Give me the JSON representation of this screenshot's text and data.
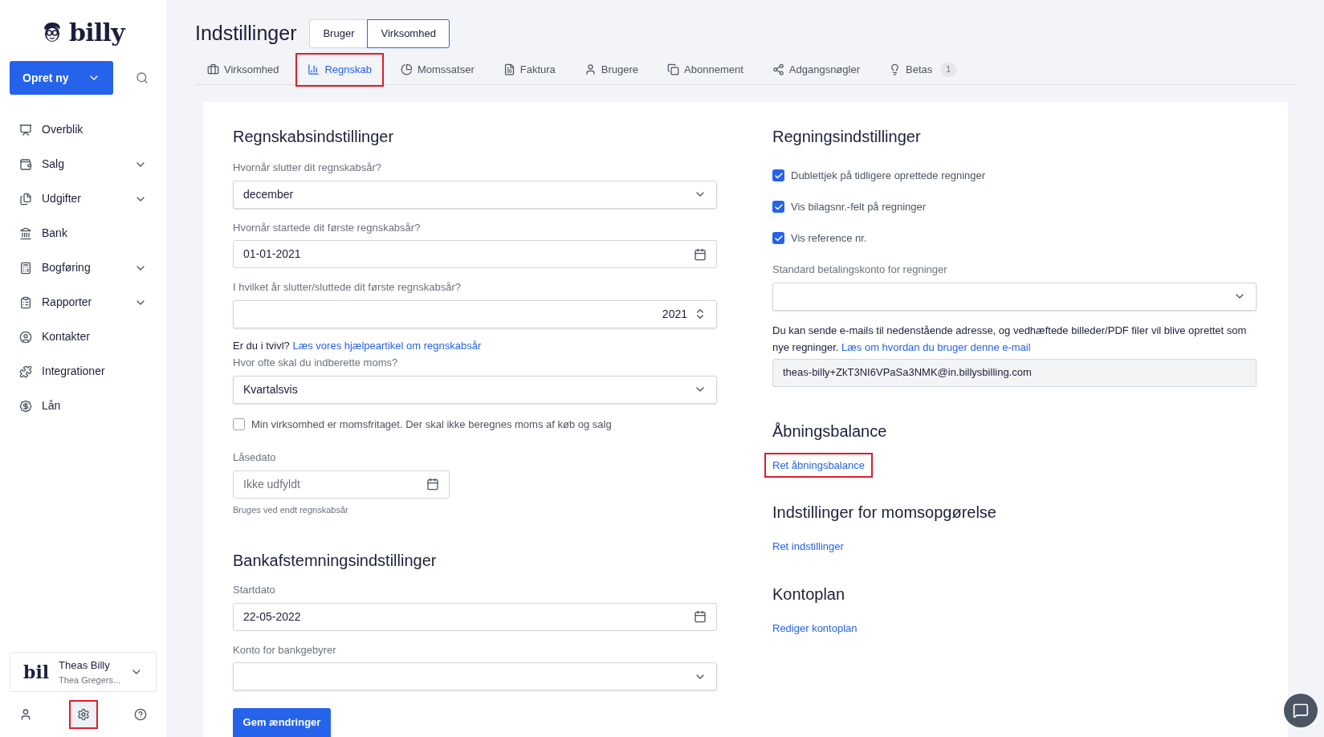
{
  "sidebar": {
    "logo": "billy",
    "create_button": "Opret ny",
    "nav": [
      {
        "label": "Overblik",
        "expandable": false
      },
      {
        "label": "Salg",
        "expandable": true
      },
      {
        "label": "Udgifter",
        "expandable": true
      },
      {
        "label": "Bank",
        "expandable": false
      },
      {
        "label": "Bogføring",
        "expandable": true
      },
      {
        "label": "Rapporter",
        "expandable": true
      },
      {
        "label": "Kontakter",
        "expandable": false
      },
      {
        "label": "Integrationer",
        "expandable": false
      },
      {
        "label": "Lån",
        "expandable": false
      }
    ],
    "account": {
      "logo": "bil",
      "name": "Theas Billy",
      "subtitle": "Thea Gregers..."
    },
    "settings_highlighted": true
  },
  "header": {
    "title": "Indstillinger",
    "scope": [
      {
        "label": "Bruger",
        "selected": false
      },
      {
        "label": "Virksomhed",
        "selected": true
      }
    ],
    "tabs": [
      {
        "label": "Virksomhed",
        "selected": false,
        "highlighted": false
      },
      {
        "label": "Regnskab",
        "selected": true,
        "highlighted": true
      },
      {
        "label": "Momssatser",
        "selected": false,
        "highlighted": false
      },
      {
        "label": "Faktura",
        "selected": false,
        "highlighted": false
      },
      {
        "label": "Brugere",
        "selected": false,
        "highlighted": false
      },
      {
        "label": "Abonnement",
        "selected": false,
        "highlighted": false
      },
      {
        "label": "Adgangsnøgler",
        "selected": false,
        "highlighted": false
      },
      {
        "label": "Betas",
        "selected": false,
        "highlighted": false,
        "badge": "1"
      }
    ]
  },
  "left": {
    "heading": "Regnskabsindstillinger",
    "fields": [
      {
        "kind": "select",
        "label": "Hvornår slutter dit regnskabsår?",
        "value": "december"
      },
      {
        "kind": "date",
        "label": "Hvornår startede dit første regnskabsår?",
        "value": "01-01-2021"
      },
      {
        "kind": "number",
        "label": "I hvilket år slutter/sluttede dit første regnskabsår?",
        "value": "2021"
      }
    ],
    "help": {
      "text": "Er du i tvivl?",
      "link": "Læs vores hjælpeartikel om regnskabsår"
    },
    "vat_field": {
      "label": "Hvor ofte skal du indberette moms?",
      "value": "Kvartalsvis"
    },
    "vat_exempt": {
      "label": "Min virksomhed er momsfritaget. Der skal ikke beregnes moms af køb og salg",
      "checked": false
    },
    "lock_date": {
      "label": "Låsedato",
      "placeholder": "Ikke udfyldt",
      "hint": "Bruges ved endt regnskabsår"
    },
    "bank_heading": "Bankafstemningsindstillinger",
    "bank_fields": [
      {
        "kind": "date",
        "label": "Startdato",
        "value": "22-05-2022"
      },
      {
        "kind": "select",
        "label": "Konto for bankgebyrer"
      }
    ],
    "save_button": "Gem ændringer"
  },
  "right": {
    "heading": "Regningsindstillinger",
    "checkboxes": [
      {
        "label": "Dublettjek på tidligere oprettede regninger",
        "checked": true
      },
      {
        "label": "Vis bilagsnr.-felt på regninger",
        "checked": true
      },
      {
        "label": "Vis reference nr.",
        "checked": true
      }
    ],
    "account_field": {
      "label": "Standard betalingskonto for regninger"
    },
    "email_text": "Du kan sende e-mails til nedenstående adresse, og vedhæftede billeder/PDF filer vil blive oprettet som nye regninger.",
    "email_link": "Læs om hvordan du bruger denne e-mail",
    "email": "theas-billy+ZkT3NI6VPaSa3NMK@in.billysbilling.com",
    "sections": [
      {
        "heading": "Åbningsbalance",
        "link": "Ret åbningsbalance",
        "highlighted": true
      },
      {
        "heading": "Indstillinger for momsopgørelse",
        "link": "Ret indstillinger",
        "highlighted": false
      },
      {
        "heading": "Kontoplan",
        "link": "Rediger kontoplan",
        "highlighted": false
      }
    ]
  }
}
